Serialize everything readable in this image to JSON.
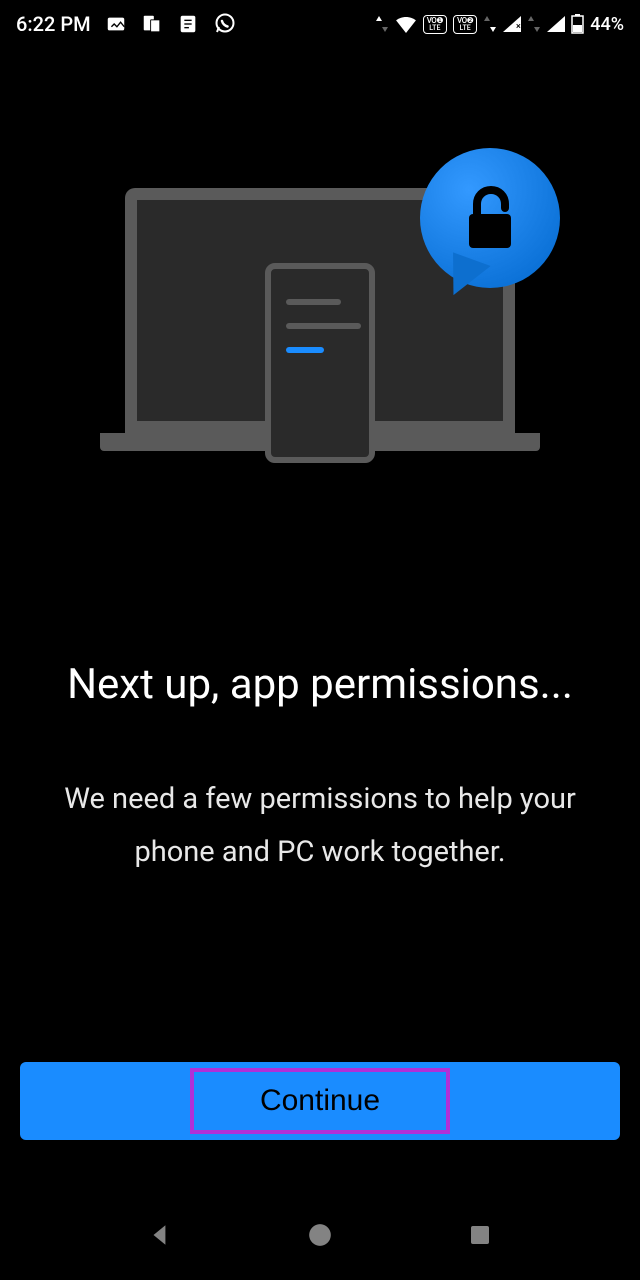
{
  "status_bar": {
    "time": "6:22 PM",
    "battery": "44%"
  },
  "content": {
    "title": "Next up, app permissions...",
    "description": "We need a few permissions to help your phone and PC work together."
  },
  "button": {
    "continue_label": "Continue"
  }
}
